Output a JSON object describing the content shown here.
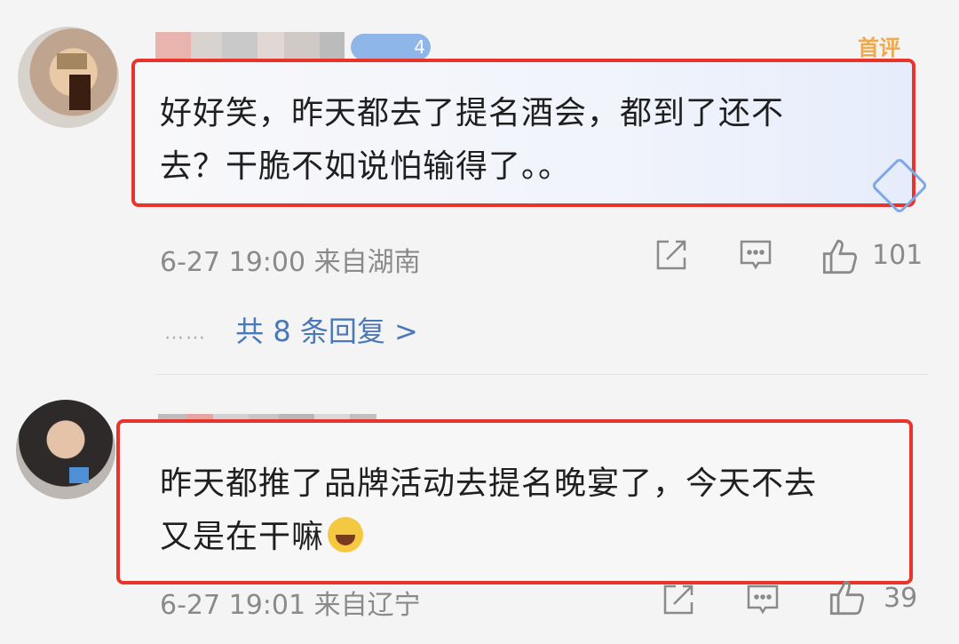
{
  "comments": [
    {
      "first_tag": "首评",
      "text_line1": "好好笑，昨天都去了提名酒会，都到了还不",
      "text_line2": "去？干脆不如说怕输得了。。",
      "meta": "6-27 19:00  来自湖南",
      "likes": "101",
      "replies_link": "共 8 条回复 >"
    },
    {
      "text_line1": "昨天都推了品牌活动去提名晚宴了，今天不去",
      "text_line2": "又是在干嘛",
      "meta": "6-27 19:01  来自辽宁",
      "likes": "39"
    }
  ],
  "icons": {
    "share": "share-icon",
    "comment": "comment-icon",
    "like": "like-icon",
    "emoji": "laughing-crying-emoji"
  },
  "colors": {
    "highlight_border": "#e8342a",
    "link": "#4b78b8",
    "meta": "#8a8a8a"
  }
}
